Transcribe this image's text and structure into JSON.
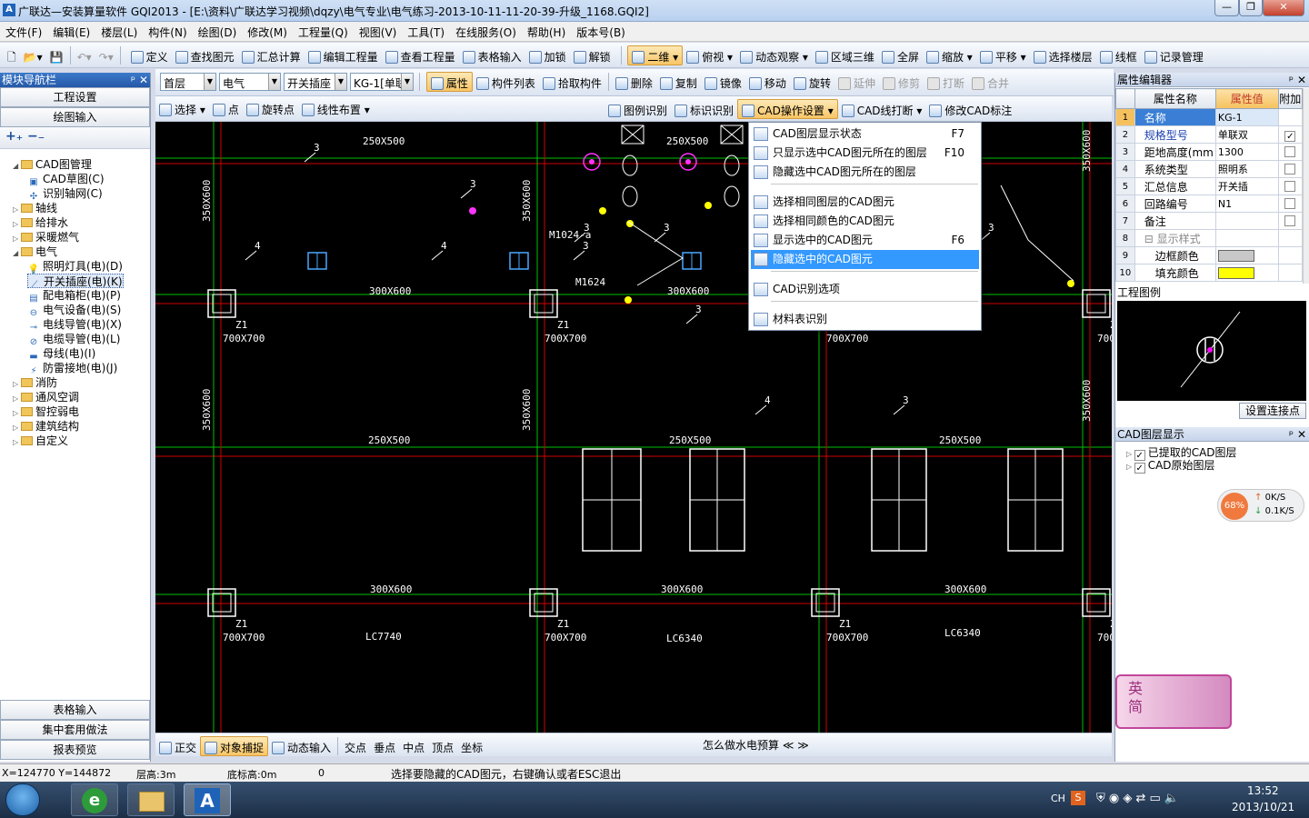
{
  "title_bar": {
    "title": "广联达—安装算量软件 GQI2013 - [E:\\资料\\广联达学习视频\\dqzy\\电气专业\\电气练习-2013-10-11-11-20-39-升级_1168.GQI2]",
    "app_icon": "A",
    "min_label": "—",
    "max_label": "❐",
    "close_label": "✕"
  },
  "menu": [
    "文件(F)",
    "编辑(E)",
    "楼层(L)",
    "构件(N)",
    "绘图(D)",
    "修改(M)",
    "工程量(Q)",
    "视图(V)",
    "工具(T)",
    "在线服务(O)",
    "帮助(H)",
    "版本号(B)"
  ],
  "toolbar1": {
    "items": [
      "定义",
      "查找图元",
      "汇总计算",
      "编辑工程量",
      "查看工程量",
      "表格输入",
      "加锁",
      "解锁"
    ],
    "view_items": [
      "二维",
      "俯视",
      "动态观察",
      "区域三维",
      "全屏",
      "缩放",
      "平移",
      "选择楼层",
      "线框",
      "记录管理"
    ]
  },
  "toolbar2": {
    "floor": "首层",
    "discipline": "电气",
    "component_type": "开关插座",
    "component": "KG-1[单联",
    "items": [
      "属性",
      "构件列表",
      "拾取构件"
    ],
    "edit_items": [
      "删除",
      "复制",
      "镜像",
      "移动",
      "旋转",
      "延伸",
      "修剪",
      "打断",
      "合并"
    ]
  },
  "toolbar3": {
    "left_items": [
      "选择",
      "点",
      "旋转点",
      "线性布置"
    ],
    "right_items": [
      "图例识别",
      "标识识别",
      "CAD操作设置",
      "CAD线打断",
      "修改CAD标注"
    ]
  },
  "left_panel": {
    "title": "模块导航栏",
    "pin": "ᵖ",
    "close": "✕",
    "top_buttons": [
      "工程设置",
      "绘图输入"
    ],
    "tree": [
      {
        "label": "CAD图管理",
        "level": 0,
        "type": "folder",
        "toggle": "◢"
      },
      {
        "label": "CAD草图(C)",
        "level": 1,
        "type": "leaf",
        "icon": "cad"
      },
      {
        "label": "识别轴网(C)",
        "level": 1,
        "type": "leaf",
        "icon": "grid"
      },
      {
        "label": "轴线",
        "level": 0,
        "type": "folder",
        "toggle": "▷"
      },
      {
        "label": "给排水",
        "level": 0,
        "type": "folder",
        "toggle": "▷"
      },
      {
        "label": "采暖燃气",
        "level": 0,
        "type": "folder",
        "toggle": "▷"
      },
      {
        "label": "电气",
        "level": 0,
        "type": "folder",
        "toggle": "◢"
      },
      {
        "label": "照明灯具(电)(D)",
        "level": 1,
        "type": "leaf",
        "icon": "bulb"
      },
      {
        "label": "开关插座(电)(K)",
        "level": 1,
        "type": "leaf",
        "icon": "switch",
        "selected": true
      },
      {
        "label": "配电箱柜(电)(P)",
        "level": 1,
        "type": "leaf",
        "icon": "box"
      },
      {
        "label": "电气设备(电)(S)",
        "level": 1,
        "type": "leaf",
        "icon": "device"
      },
      {
        "label": "电线导管(电)(X)",
        "level": 1,
        "type": "leaf",
        "icon": "wire"
      },
      {
        "label": "电缆导管(电)(L)",
        "level": 1,
        "type": "leaf",
        "icon": "cable"
      },
      {
        "label": "母线(电)(I)",
        "level": 1,
        "type": "leaf",
        "icon": "bus"
      },
      {
        "label": "防雷接地(电)(J)",
        "level": 1,
        "type": "leaf",
        "icon": "lightning"
      },
      {
        "label": "消防",
        "level": 0,
        "type": "folder",
        "toggle": "▷"
      },
      {
        "label": "通风空调",
        "level": 0,
        "type": "folder",
        "toggle": "▷"
      },
      {
        "label": "智控弱电",
        "level": 0,
        "type": "folder",
        "toggle": "▷"
      },
      {
        "label": "建筑结构",
        "level": 0,
        "type": "folder",
        "toggle": "▷"
      },
      {
        "label": "自定义",
        "level": 0,
        "type": "folder",
        "toggle": "▷"
      }
    ],
    "bottom_buttons": [
      "表格输入",
      "集中套用做法",
      "报表预览"
    ]
  },
  "dropdown_menu": {
    "items": [
      {
        "label": "CAD图层显示状态",
        "key": "F7"
      },
      {
        "label": "只显示选中CAD图元所在的图层",
        "key": "F10"
      },
      {
        "label": "隐藏选中CAD图元所在的图层",
        "key": ""
      },
      {
        "label": "选择相同图层的CAD图元",
        "key": ""
      },
      {
        "label": "选择相同颜色的CAD图元",
        "key": ""
      },
      {
        "label": "显示选中的CAD图元",
        "key": "F6"
      },
      {
        "label": "隐藏选中的CAD图元",
        "key": "",
        "highlighted": true
      },
      {
        "label": "CAD识别选项",
        "key": ""
      },
      {
        "label": "材料表识别",
        "key": ""
      }
    ]
  },
  "cad_labels": {
    "beam_top": [
      "250X500",
      "250X500",
      "300X600",
      "300X600"
    ],
    "beam_mid": [
      "250X500",
      "250X500",
      "250X500"
    ],
    "beam_bottom": [
      "300X600",
      "300X600",
      "300X600"
    ],
    "beam_vertical": [
      "350X600",
      "350X600",
      "350X600",
      "350X600",
      "350X600",
      "350X600"
    ],
    "column_name": "Z1",
    "column_size": "700X700",
    "door_labels": [
      "M1024-a",
      "M1624"
    ],
    "window_labels": [
      "LC7740",
      "LC6340",
      "LC6340"
    ],
    "wire_counts": [
      "3",
      "3",
      "4",
      "4",
      "3",
      "3",
      "3",
      "4",
      "3",
      "3",
      "3"
    ]
  },
  "snap_bar": {
    "items": [
      "正交",
      "对象捕捉",
      "动态输入"
    ],
    "snap_items": [
      "交点",
      "垂点",
      "中点",
      "顶点",
      "坐标"
    ],
    "help_text": "怎么做水电预算"
  },
  "status_bar": {
    "coords": "X=124770 Y=144872",
    "floor_height": "层高:3m",
    "base_elevation": "底标高:0m",
    "value": "0",
    "prompt": "选择要隐藏的CAD图元，右键确认或者ESC退出"
  },
  "right_panel": {
    "property_editor_title": "属性编辑器",
    "headers": [
      "属性名称",
      "属性值",
      "附加"
    ],
    "rows": [
      {
        "n": "1",
        "name": "名称",
        "value": "KG-1",
        "check": false,
        "hasCheck": false,
        "style": "sel"
      },
      {
        "n": "2",
        "name": "规格型号",
        "value": "单联双",
        "check": true,
        "hasCheck": true,
        "style": "blue"
      },
      {
        "n": "3",
        "name": "距地高度(mm",
        "value": "1300",
        "check": false,
        "hasCheck": true,
        "style": ""
      },
      {
        "n": "4",
        "name": "系统类型",
        "value": "照明系",
        "check": false,
        "hasCheck": true,
        "style": ""
      },
      {
        "n": "5",
        "name": "汇总信息",
        "value": "开关插",
        "check": false,
        "hasCheck": true,
        "style": ""
      },
      {
        "n": "6",
        "name": "回路编号",
        "value": "N1",
        "check": false,
        "hasCheck": true,
        "style": ""
      },
      {
        "n": "7",
        "name": "备注",
        "value": "",
        "check": false,
        "hasCheck": true,
        "style": ""
      },
      {
        "n": "8",
        "name": "显示样式",
        "value": "",
        "check": false,
        "hasCheck": false,
        "style": "group"
      },
      {
        "n": "9",
        "name": "边框颜色",
        "value": "",
        "check": false,
        "hasCheck": false,
        "style": "swatch-gray"
      },
      {
        "n": "10",
        "name": "填充颜色",
        "value": "",
        "check": false,
        "hasCheck": false,
        "style": "swatch-yellow"
      }
    ],
    "legend_title": "工程图例",
    "set_connection_button": "设置连接点",
    "layer_title": "CAD图层显示",
    "layers": [
      "已提取的CAD图层",
      "CAD原始图层"
    ],
    "net_percent": "68%",
    "net_up": "0K/S",
    "net_down": "0.1K/S",
    "ime_text": "英\n简"
  },
  "taskbar": {
    "lang": "CH",
    "time": "13:52",
    "date": "2013/10/21"
  },
  "colors": {
    "selection": "#3399ff",
    "panel_header": "#2458a8",
    "cad_background": "#000000"
  }
}
